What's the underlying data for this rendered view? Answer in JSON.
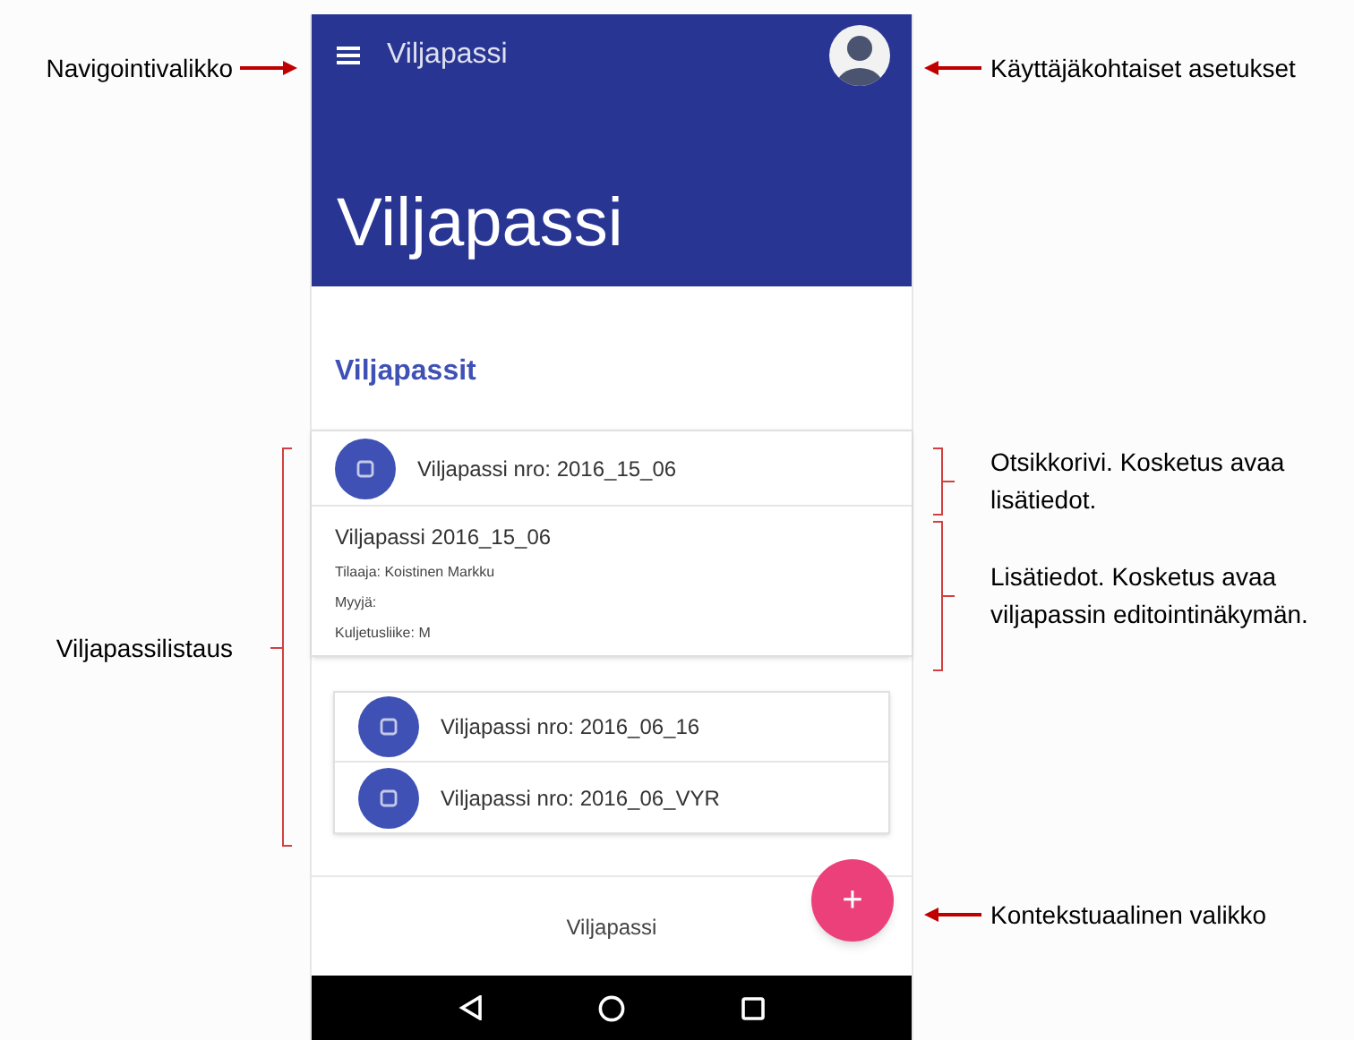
{
  "annotations": [
    {
      "text": "Navigointivalikko",
      "kind": "arrow"
    },
    {
      "text": "Käyttäjäkohtaiset asetukset",
      "kind": "arrow"
    },
    {
      "text": "Otsikkorivi. Kosketus avaa lisätiedot.",
      "kind": "bracket"
    },
    {
      "text": "Lisätiedot. Kosketus avaa viljapassin editointinäkymän.",
      "kind": "bracket"
    },
    {
      "text": "Viljapassilistaus",
      "kind": "bracket"
    },
    {
      "text": "Kontekstuaalinen valikko",
      "kind": "arrow"
    }
  ],
  "app_bar": {
    "title": "Viljapassi",
    "large_title": "Viljapassi"
  },
  "section_title": "Viljapassit",
  "passes": [
    {
      "title": "Viljapassi nro: 2016_15_06",
      "expanded": true,
      "details": {
        "heading": "Viljapassi 2016_15_06",
        "lines": [
          "Tilaaja: Koistinen Markku",
          "Myyjä:",
          "Kuljetusliike: M"
        ]
      }
    },
    {
      "title": "Viljapassi nro: 2016_06_16",
      "expanded": false
    },
    {
      "title": "Viljapassi nro: 2016_06_VYR",
      "expanded": false
    }
  ],
  "bottom_bar": {
    "label": "Viljapassi"
  },
  "fab": {
    "label": "+"
  }
}
